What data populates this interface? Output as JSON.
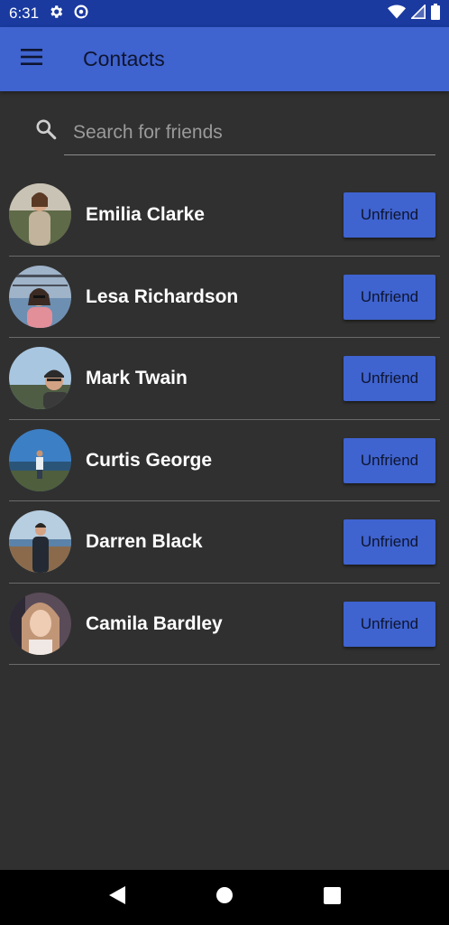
{
  "status_bar": {
    "time": "6:31",
    "left_icons": [
      "gear-icon",
      "data-saver-icon"
    ],
    "right_icons": [
      "wifi-icon",
      "signal-icon",
      "battery-icon"
    ]
  },
  "app_bar": {
    "title": "Contacts",
    "menu_icon": "hamburger-menu-icon"
  },
  "search": {
    "placeholder": "Search for friends",
    "value": ""
  },
  "contacts": [
    {
      "name": "Emilia Clarke",
      "button_label": "Unfriend"
    },
    {
      "name": "Lesa Richardson",
      "button_label": "Unfriend"
    },
    {
      "name": "Mark Twain",
      "button_label": "Unfriend"
    },
    {
      "name": "Curtis George",
      "button_label": "Unfriend"
    },
    {
      "name": "Darren Black",
      "button_label": "Unfriend"
    },
    {
      "name": "Camila Bardley",
      "button_label": "Unfriend"
    }
  ],
  "nav_bar": {
    "buttons": [
      "back-icon",
      "home-icon",
      "recents-icon"
    ]
  },
  "colors": {
    "status_bar": "#1a3aa0",
    "app_bar": "#3f63cf",
    "background": "#303030",
    "button": "#3f63cf",
    "title_text": "#0e1530"
  }
}
